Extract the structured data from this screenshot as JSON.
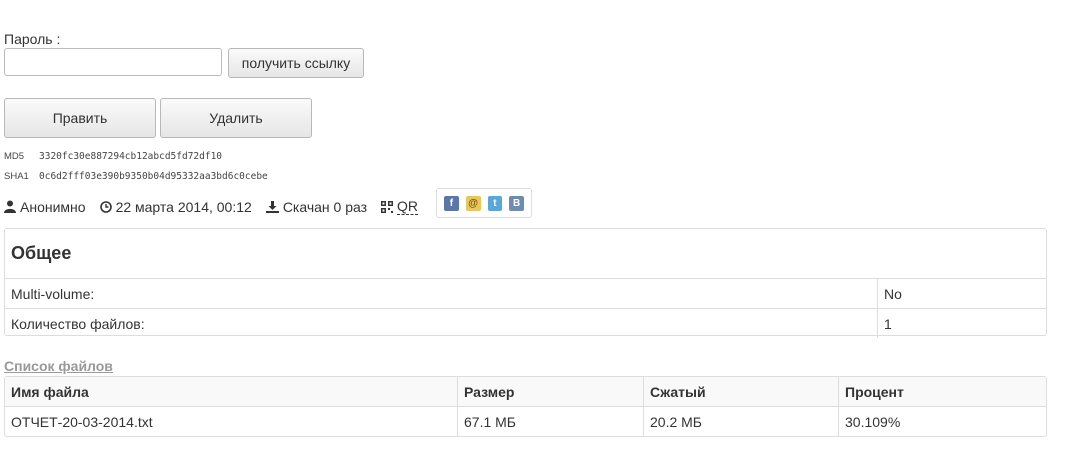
{
  "password": {
    "label": "Пароль :",
    "value": "",
    "get_link_button": "получить ссылку"
  },
  "actions": {
    "edit_button": "Править",
    "delete_button": "Удалить"
  },
  "hashes": [
    {
      "name": "MD5",
      "value": "3320fc30e887294cb12abcd5fd72df10"
    },
    {
      "name": "SHA1",
      "value": "0c6d2fff03e390b9350b04d95332aa3bd6c0cebe"
    }
  ],
  "meta": {
    "author": "Анонимно",
    "date": "22 марта 2014, 00:12",
    "downloads": "Скачан 0 раз",
    "qr": "QR"
  },
  "share_icons": [
    "facebook-icon",
    "mail-icon",
    "twitter-icon",
    "vkontakte-icon"
  ],
  "general": {
    "title": "Общее",
    "rows": [
      {
        "key": "Multi-volume:",
        "value": "No"
      },
      {
        "key": "Количество файлов:",
        "value": "1"
      }
    ]
  },
  "files": {
    "link": "Список файлов",
    "headers": [
      "Имя файла",
      "Размер",
      "Сжатый",
      "Процент"
    ],
    "rows": [
      [
        "ОТЧЕТ-20-03-2014.txt",
        "67.1 МБ",
        "20.2 МБ",
        "30.109%"
      ]
    ]
  },
  "colors": {
    "link_gray": "#999999",
    "border": "#dddddd"
  }
}
